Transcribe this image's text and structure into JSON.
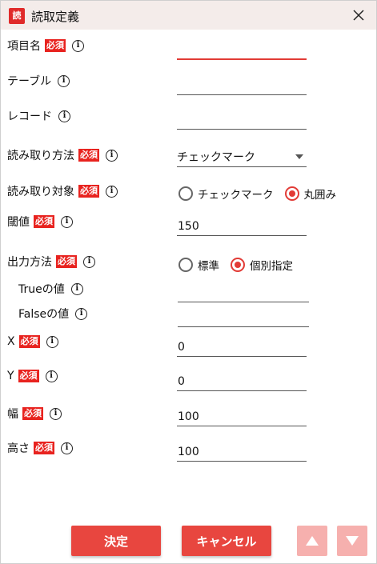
{
  "window": {
    "title": "読取定義",
    "icon_text": "読"
  },
  "required_badge": "必須",
  "fields": {
    "item_name": {
      "label": "項目名",
      "value": ""
    },
    "table": {
      "label": "テーブル",
      "value": ""
    },
    "record": {
      "label": "レコード",
      "value": ""
    },
    "read_method": {
      "label": "読み取り方法",
      "selected": "チェックマーク"
    },
    "read_target": {
      "label": "読み取り対象",
      "options": [
        "チェックマーク",
        "丸囲み"
      ],
      "selected": "丸囲み"
    },
    "threshold": {
      "label": "閾値",
      "value": "150"
    },
    "output_method": {
      "label": "出力方法",
      "options": [
        "標準",
        "個別指定"
      ],
      "selected": "個別指定"
    },
    "true_value": {
      "label": "Trueの値",
      "value": ""
    },
    "false_value": {
      "label": "Falseの値",
      "value": ""
    },
    "x": {
      "label": "X",
      "value": "0"
    },
    "y": {
      "label": "Y",
      "value": "0"
    },
    "width": {
      "label": "幅",
      "value": "100"
    },
    "height": {
      "label": "高さ",
      "value": "100"
    }
  },
  "buttons": {
    "ok": "決定",
    "cancel": "キャンセル"
  },
  "colors": {
    "accent": "#e8463f",
    "required": "#e8231f",
    "disabled_arrow": "#f6b0ae",
    "titlebar": "#f4ecea"
  }
}
